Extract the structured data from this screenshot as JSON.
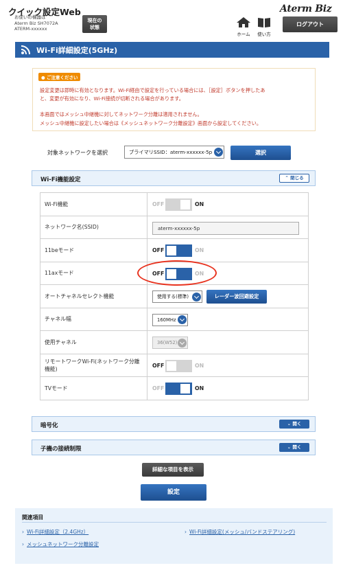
{
  "header": {
    "app_title": "クイック設定Web",
    "device_label": "お使いの機器は",
    "device_model": "Aterm Biz SH7072A",
    "device_name": "ATERM-xxxxxx",
    "status_button": "現在の状態",
    "brand": "Aterm Biz",
    "home_label": "ホーム",
    "manual_label": "使い方",
    "logout_button": "ログアウト"
  },
  "page_title": "Wi-Fi詳細設定(5GHz)",
  "notice": {
    "badge": "ご注意ください",
    "lines": [
      "設定変更は即時に有効となります。Wi-Fi経由で設定を行っている場合には、［設定］ボタンを押したあ",
      "と、変更が有効になり、Wi-Fi接続が切断される場合があります。",
      "本画面ではメッシュ中継機に対してネットワーク分離は適用されません。",
      "メッシュ中継機に設定したい場合は《メッシュネットワーク分離設定》画面から設定してください。"
    ]
  },
  "network_select": {
    "label": "対象ネットワークを選択",
    "value": "プライマリSSID：aterm-xxxxxx-5p",
    "button": "選択"
  },
  "wifi_section": {
    "title": "Wi-Fi機能設定",
    "collapse_button": "閉じる",
    "off": "OFF",
    "on": "ON",
    "rows": {
      "wifi_function": {
        "label": "Wi-Fi機能",
        "state": "on",
        "enabled": false
      },
      "ssid": {
        "label": "ネットワーク名(SSID)",
        "value": "aterm-xxxxxx-5p"
      },
      "mode_11be": {
        "label": "11beモード",
        "state": "off",
        "enabled": true
      },
      "mode_11ax": {
        "label": "11axモード",
        "state": "off",
        "enabled": true
      },
      "auto_channel": {
        "label": "オートチャネルセレクト機能",
        "value": "使用する(標準)",
        "radar_button": "レーダー波回避設定"
      },
      "channel_width": {
        "label": "チャネル幅",
        "value": "160MHz"
      },
      "channel": {
        "label": "使用チャネル",
        "value": "36(W52)"
      },
      "remote_work": {
        "label_line1": "リモートワークWi-Fi(ネットワーク分離",
        "label_line2": "機能)",
        "state": "off",
        "enabled": false
      },
      "tv_mode": {
        "label": "TVモード",
        "state": "on",
        "enabled": true
      }
    }
  },
  "encryption_section": {
    "title": "暗号化",
    "expand_button": "開く"
  },
  "access_limit_section": {
    "title": "子機の接続制限",
    "expand_button": "開く"
  },
  "show_details_button": "詳細な項目を表示",
  "apply_button": "設定",
  "related": {
    "title": "関連項目",
    "links": [
      "Wi-Fi詳細設定（2.4GHz）",
      "Wi-Fi詳細設定(メッシュ/バンドステアリング)",
      "メッシュネットワーク分離設定"
    ]
  },
  "colors": {
    "primary_blue": "#2a62a8",
    "notice_red": "#c0392b",
    "notice_badge": "#ef8b00",
    "highlight_circle": "#e8321e"
  }
}
